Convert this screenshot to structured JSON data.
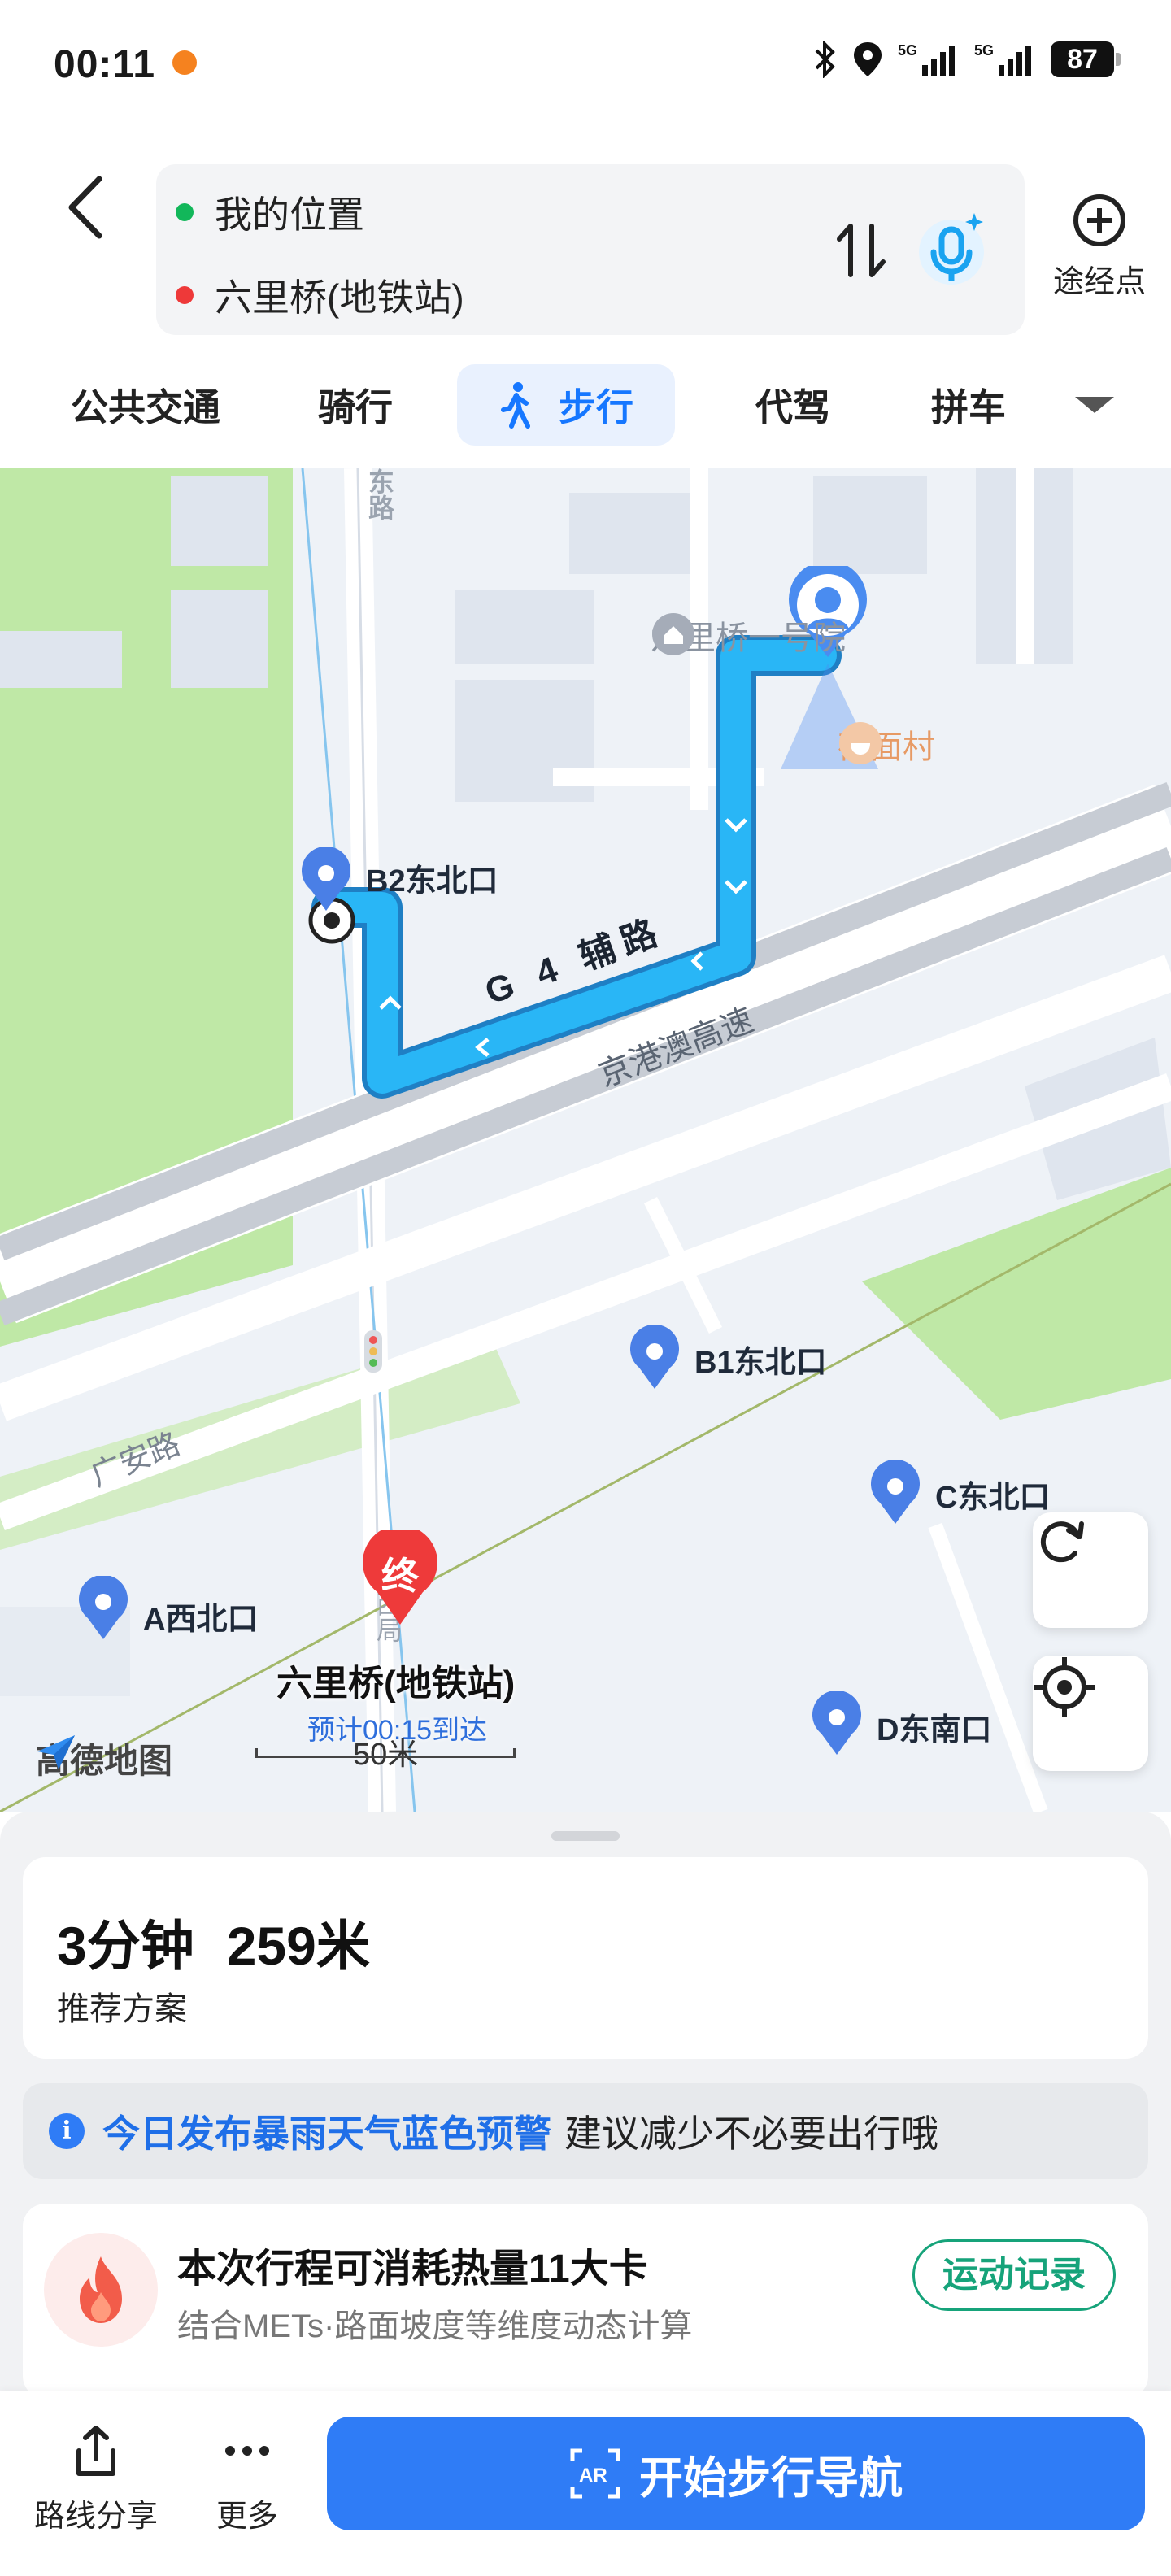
{
  "status_bar": {
    "time": "00:11",
    "battery": "87",
    "network": "5G"
  },
  "route": {
    "origin": "我的位置",
    "destination": "六里桥(地铁站)",
    "waypoint_label": "途经点"
  },
  "tabs": [
    {
      "label": "公共交通"
    },
    {
      "label": "骑行"
    },
    {
      "label": "步行",
      "active": true
    },
    {
      "label": "代驾"
    },
    {
      "label": "拼车"
    }
  ],
  "map": {
    "road_g4": "G 4 辅路",
    "road_expressway": "京港澳高速",
    "road_guangan": "广安路",
    "road_east": "东路",
    "road_west": "西局",
    "poi_yard": "六里桥一号院",
    "poi_restaurant": "莜面村",
    "exits": {
      "b2": "B2东北口",
      "b1": "B1东北口",
      "c": "C东北口",
      "a": "A西北口",
      "d": "D东南口"
    },
    "end_badge": "终",
    "destination_title": "六里桥(地铁站)",
    "destination_eta": "预计00:15到达",
    "brand": "高德地图",
    "scale": "50米"
  },
  "plan": {
    "duration": "3分钟",
    "distance": "259米",
    "label": "推荐方案"
  },
  "alert": {
    "highlight": "今日发布暴雨天气蓝色预警",
    "text": "建议减少不必要出行哦"
  },
  "calorie": {
    "title": "本次行程可消耗热量11大卡",
    "subtitle": "结合METs·路面坡度等维度动态计算",
    "button": "运动记录"
  },
  "actions": {
    "share": "路线分享",
    "more": "更多",
    "start_nav": "开始步行导航"
  },
  "colors": {
    "accent": "#2f7cf6",
    "route": "#29b6f6",
    "green": "#16a37a"
  }
}
